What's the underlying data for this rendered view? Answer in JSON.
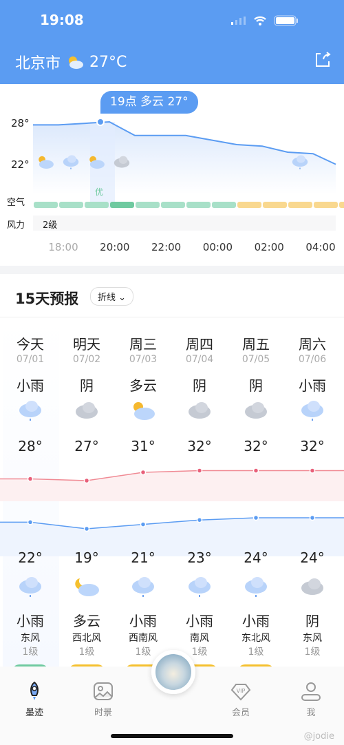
{
  "status_bar": {
    "time": "19:08"
  },
  "header": {
    "city": "北京市",
    "icon": "partly-cloudy-icon",
    "temp": "27°C",
    "share_icon": "share-icon",
    "accent": "#5b9cf2"
  },
  "hourly": {
    "tooltip": "19点 多云 27°",
    "y_labels": [
      "28°",
      "22°"
    ],
    "air_label": "空气",
    "air_selected": "优",
    "wind_label": "风力",
    "wind_value": "2级",
    "x_labels": [
      "18:00",
      "20:00",
      "22:00",
      "00:00",
      "02:00",
      "04:00"
    ],
    "icons": [
      "partly-cloudy-icon",
      "light-rain-icon",
      "partly-cloudy-icon",
      "overcast-icon",
      "",
      "",
      "",
      "",
      "",
      "",
      "light-rain-icon",
      "",
      ""
    ],
    "air_levels": [
      "优",
      "优",
      "优",
      "优",
      "优",
      "优",
      "优",
      "优",
      "良",
      "良",
      "良",
      "良",
      "良"
    ],
    "temps": [
      27.8,
      27.8,
      27.9,
      28.0,
      27.1,
      27.1,
      27.1,
      26.8,
      26.5,
      26.4,
      26.0,
      25.9,
      25.2
    ],
    "colors": {
      "good": "#a8e0c8",
      "good_selected": "#6fcaa0",
      "moderate": "#f9d88f"
    }
  },
  "daily": {
    "title": "15天预报",
    "mode": "折线",
    "days": [
      {
        "name": "今天",
        "date": "07/01",
        "day_weather": "小雨",
        "day_icon": "light-rain-icon",
        "high": "28°",
        "low": "22°",
        "night_icon": "light-rain-icon",
        "night_weather": "小雨",
        "wind_dir": "东风",
        "wind_level": "1级",
        "aqi": "优",
        "high_v": 28,
        "low_v": 22
      },
      {
        "name": "明天",
        "date": "07/02",
        "day_weather": "阴",
        "day_icon": "overcast-icon",
        "high": "27°",
        "low": "19°",
        "night_icon": "moon-cloud-icon",
        "night_weather": "多云",
        "wind_dir": "西北风",
        "wind_level": "1级",
        "aqi": "良",
        "high_v": 27,
        "low_v": 19
      },
      {
        "name": "周三",
        "date": "07/03",
        "day_weather": "多云",
        "day_icon": "partly-cloudy-icon",
        "high": "31°",
        "low": "21°",
        "night_icon": "light-rain-icon",
        "night_weather": "小雨",
        "wind_dir": "西南风",
        "wind_level": "1级",
        "aqi": "良",
        "high_v": 31,
        "low_v": 21
      },
      {
        "name": "周四",
        "date": "07/04",
        "day_weather": "阴",
        "day_icon": "overcast-icon",
        "high": "32°",
        "low": "23°",
        "night_icon": "light-rain-icon",
        "night_weather": "小雨",
        "wind_dir": "南风",
        "wind_level": "1级",
        "aqi": "良",
        "high_v": 32,
        "low_v": 23
      },
      {
        "name": "周五",
        "date": "07/05",
        "day_weather": "阴",
        "day_icon": "overcast-icon",
        "high": "32°",
        "low": "24°",
        "night_icon": "light-rain-icon",
        "night_weather": "小雨",
        "wind_dir": "东北风",
        "wind_level": "1级",
        "aqi": "良",
        "high_v": 32,
        "low_v": 24
      },
      {
        "name": "周六",
        "date": "07/06",
        "day_weather": "小雨",
        "day_icon": "light-rain-icon",
        "high": "32°",
        "low": "24°",
        "night_icon": "overcast-icon",
        "night_weather": "阴",
        "wind_dir": "东风",
        "wind_level": "1级",
        "aqi": "",
        "high_v": 32,
        "low_v": 24
      }
    ],
    "colors": {
      "high": "#f08a94",
      "low": "#5b9cf2",
      "aqi_good": "#6fcaa0",
      "aqi_moderate": "#f5c02e"
    }
  },
  "tabbar": {
    "tabs": [
      {
        "label": "墨迹",
        "icon": "rocket-icon"
      },
      {
        "label": "时景",
        "icon": "image-icon"
      },
      {
        "label": "会员",
        "icon": "vip-icon"
      },
      {
        "label": "我",
        "icon": "user-icon"
      }
    ]
  },
  "watermark": "@jodie"
}
